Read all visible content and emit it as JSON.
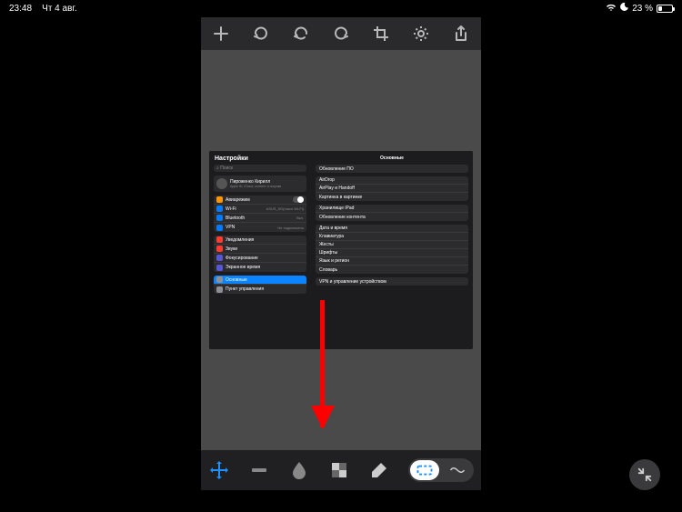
{
  "statusbar": {
    "time": "23:48",
    "date": "Чт 4 авг.",
    "battery_pct": "23 %"
  },
  "top_toolbar": {
    "add": "+",
    "rotate": "↻",
    "undo": "↶",
    "redo": "↷",
    "crop": "Crop",
    "settings": "⚙",
    "share": "Share"
  },
  "screenshot": {
    "title": "Настройки",
    "search_placeholder": "Поиск",
    "profile": {
      "name": "Пироженко Кирилл",
      "sub": "Apple ID, iCloud, контент и покупки"
    },
    "group_net": [
      {
        "icon_color": "#ff9500",
        "label": "Авиарежим",
        "toggle": true
      },
      {
        "icon_color": "#007aff",
        "label": "Wi-Fi",
        "value": "ASUS_5G(macn Wi-Fi)"
      },
      {
        "icon_color": "#007aff",
        "label": "Bluetooth",
        "value": "Вкл."
      },
      {
        "icon_color": "#007aff",
        "label": "VPN",
        "value": "Не подключено"
      }
    ],
    "group_notif": [
      {
        "icon_color": "#ff3b30",
        "label": "Уведомления"
      },
      {
        "icon_color": "#ff3b30",
        "label": "Звуки"
      },
      {
        "icon_color": "#5856d6",
        "label": "Фокусирование"
      },
      {
        "icon_color": "#5856d6",
        "label": "Экранное время"
      }
    ],
    "group_general": [
      {
        "icon_color": "#8e8e93",
        "label": "Основные",
        "selected": true
      },
      {
        "icon_color": "#8e8e93",
        "label": "Пункт управления"
      }
    ],
    "detail_title": "Основные",
    "detail_groups": [
      [
        "Обновление ПО"
      ],
      [
        "AirDrop",
        "AirPlay и Handoff",
        "Картинка в картинке"
      ],
      [
        "Хранилище iPad",
        "Обновление контента"
      ],
      [
        "Дата и время",
        "Клавиатура",
        "Жесты",
        "Шрифты",
        "Язык и регион",
        "Словарь"
      ],
      [
        "VPN и управление устройством"
      ]
    ]
  },
  "bottom_toolbar": {
    "move": "Move",
    "erase_bar": "Erase",
    "blur": "Blur",
    "pixelate": "Pixelate",
    "eraser": "Eraser",
    "select_rect": "Rectangle",
    "select_lasso": "Lasso"
  }
}
